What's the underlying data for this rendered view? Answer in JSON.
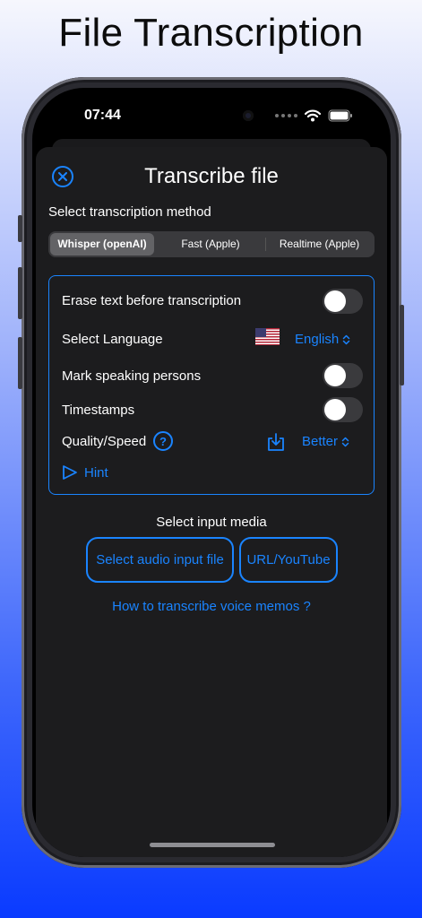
{
  "headline": "File Transcription",
  "status_bar": {
    "time": "07:44"
  },
  "sheet": {
    "title": "Transcribe file",
    "method_label": "Select transcription method",
    "methods": [
      {
        "label": "Whisper (openAI)",
        "selected": true
      },
      {
        "label": "Fast (Apple)",
        "selected": false
      },
      {
        "label": "Realtime (Apple)",
        "selected": false
      }
    ],
    "options": {
      "erase_text": {
        "label": "Erase text before transcription",
        "on": false
      },
      "language": {
        "label": "Select Language",
        "value": "English"
      },
      "mark_speakers": {
        "label": "Mark speaking persons",
        "on": false
      },
      "timestamps": {
        "label": "Timestamps",
        "on": false
      },
      "quality": {
        "label": "Quality/Speed",
        "value": "Better"
      },
      "hint": "Hint"
    },
    "input_media_label": "Select input media",
    "select_audio_button": "Select audio input file",
    "url_button": "URL/YouTube",
    "voice_memos_link": "How to transcribe voice memos ?"
  },
  "colors": {
    "accent": "#1a84ff",
    "sheet_background": "#1c1c1e",
    "toggle_off": "#3a3a3d"
  },
  "icons": [
    "close-circle-icon",
    "us-flag-icon",
    "chevron-updown-icon",
    "question-circle-icon",
    "download-icon",
    "play-outline-icon",
    "wifi-icon",
    "battery-icon",
    "camera-icon"
  ]
}
